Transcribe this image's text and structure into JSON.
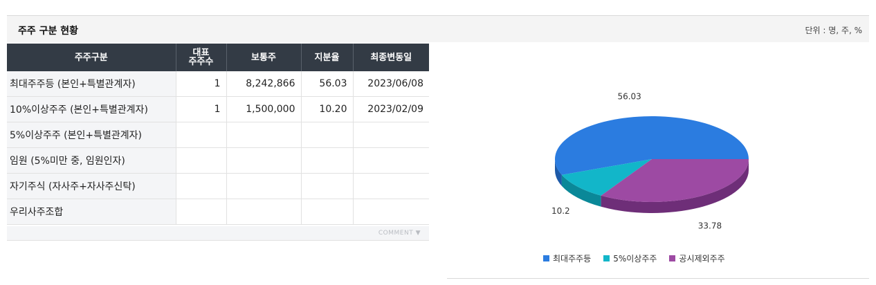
{
  "section": {
    "title": "주주 구분 현황",
    "unit": "단위 : 명, 주, %"
  },
  "table": {
    "headers": [
      "주주구분",
      "대표\n주주수",
      "보통주",
      "지분율",
      "최종변동일"
    ],
    "rows": [
      {
        "category": "최대주주등 (본인+특별관계자)",
        "holders": "1",
        "shares": "8,242,866",
        "ratio": "56.03",
        "date": "2023/06/08"
      },
      {
        "category": "10%이상주주 (본인+특별관계자)",
        "holders": "1",
        "shares": "1,500,000",
        "ratio": "10.20",
        "date": "2023/02/09"
      },
      {
        "category": "5%이상주주 (본인+특별관계자)",
        "holders": "",
        "shares": "",
        "ratio": "",
        "date": ""
      },
      {
        "category": "임원 (5%미만 중, 임원인자)",
        "holders": "",
        "shares": "",
        "ratio": "",
        "date": ""
      },
      {
        "category": "자기주식 (자사주+자사주신탁)",
        "holders": "",
        "shares": "",
        "ratio": "",
        "date": ""
      },
      {
        "category": "우리사주조합",
        "holders": "",
        "shares": "",
        "ratio": "",
        "date": ""
      }
    ],
    "comment_label": "COMMENT"
  },
  "chart_data": {
    "type": "pie",
    "title": "",
    "categories": [
      "최대주주등",
      "5%이상주주",
      "공시제외주주"
    ],
    "values": [
      56.03,
      10.2,
      33.78
    ],
    "data_labels": [
      "56.03",
      "10.2",
      "33.78"
    ],
    "colors": [
      "#2b7ce0",
      "#12b6c9",
      "#9d4aa3"
    ],
    "side_colors": [
      "#1d5aa8",
      "#0a8898",
      "#6e2e78"
    ],
    "style": "3d",
    "legend": "bottom"
  }
}
